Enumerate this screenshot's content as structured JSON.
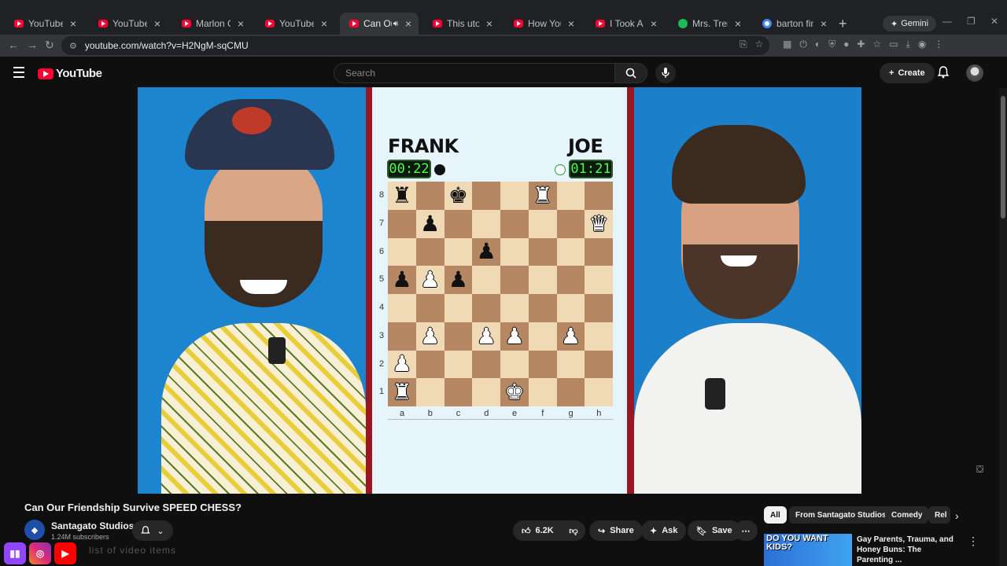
{
  "browser": {
    "tabs": [
      {
        "title": "YouTube",
        "icon": "youtube-icon"
      },
      {
        "title": "YouTube",
        "icon": "youtube-icon"
      },
      {
        "title": "Marlon Gets",
        "icon": "youtube-icon"
      },
      {
        "title": "YouTube",
        "icon": "youtube-icon"
      },
      {
        "title": "Can Our Frie",
        "icon": "youtube-icon",
        "active": true
      },
      {
        "title": "This utopia",
        "icon": "youtube-icon"
      },
      {
        "title": "How Your Pa",
        "icon": "youtube-icon"
      },
      {
        "title": "I Took A Bat",
        "icon": "youtube-icon"
      },
      {
        "title": "Mrs. Trends",
        "icon": "spotify-icon"
      },
      {
        "title": "barton fink",
        "icon": "google-icon"
      }
    ],
    "gemini_label": "Gemini",
    "url": "youtube.com/watch?v=H2NgM-sqCMU"
  },
  "youtube": {
    "logo_text": "YouTube",
    "search_placeholder": "Search",
    "create_label": "Create"
  },
  "video": {
    "player_left": "FRANK",
    "player_right": "JOE",
    "clock_left": "00:22",
    "clock_right": "01:21",
    "ranks": [
      "8",
      "7",
      "6",
      "5",
      "4",
      "3",
      "2",
      "1"
    ],
    "files": [
      "a",
      "b",
      "c",
      "d",
      "e",
      "f",
      "g",
      "h"
    ],
    "board": [
      [
        "bR",
        "",
        "bK",
        "",
        "",
        "wR",
        "",
        ""
      ],
      [
        "",
        "bP",
        "",
        "",
        "",
        "",
        "",
        "wQ"
      ],
      [
        "",
        "",
        "",
        "bP",
        "",
        "",
        "",
        ""
      ],
      [
        "bP",
        "wP",
        "bP",
        "",
        "",
        "",
        "",
        ""
      ],
      [
        "",
        "",
        "",
        "",
        "",
        "",
        "",
        ""
      ],
      [
        "",
        "wP",
        "",
        "wP",
        "wP",
        "",
        "wP",
        ""
      ],
      [
        "wP",
        "",
        "",
        "",
        "",
        "",
        "",
        ""
      ],
      [
        "wR",
        "",
        "",
        "",
        "wK",
        "",
        "",
        ""
      ]
    ]
  },
  "meta": {
    "title": "Can Our Friendship Survive SPEED CHESS?",
    "channel_name": "Santagato Studios",
    "subscribers": "1.24M subscribers",
    "likes": "6.2K",
    "share_label": "Share",
    "ask_label": "Ask",
    "save_label": "Save"
  },
  "chips": [
    "All",
    "From Santagato Studios",
    "Comedy",
    "Rel"
  ],
  "recommendation": {
    "thumb_text": "DO YOU WANT KIDS?",
    "title": "Gay Parents, Trauma, and Honey Buns: The Parenting ..."
  },
  "ghost_text": "list of video items"
}
